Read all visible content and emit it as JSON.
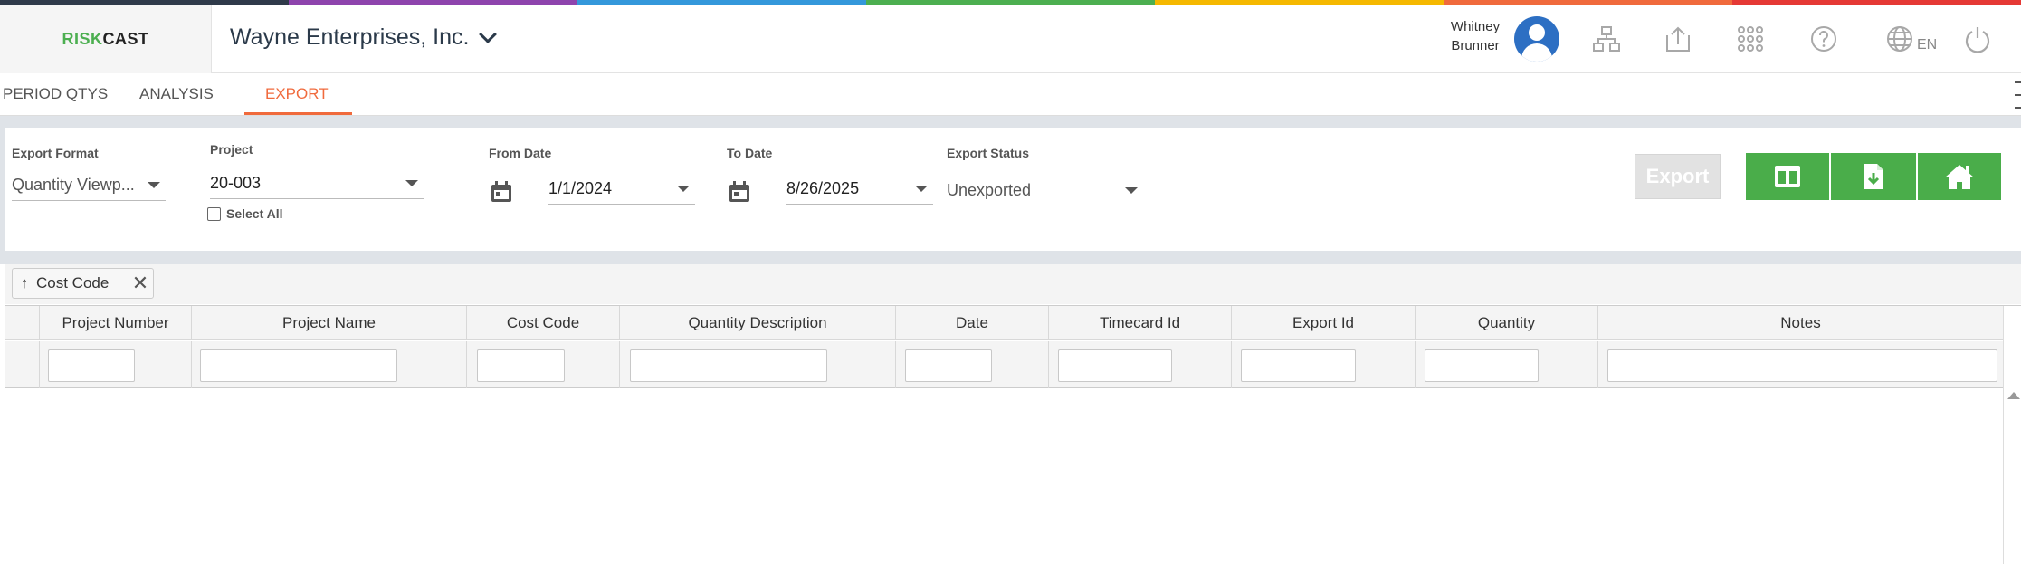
{
  "colors": {
    "rainbow": [
      "#2f3a4a",
      "#8e44ad",
      "#3498db",
      "#4caf50",
      "#f5b800",
      "#f06a3c",
      "#e53935"
    ],
    "accent": "#f06a3c",
    "green_button": "#4aad4a",
    "avatar": "#2d6fc3"
  },
  "logo": {
    "part1": "RISK",
    "part2": "CAST"
  },
  "header": {
    "company": "Wayne Enterprises, Inc.",
    "user_first": "Whitney",
    "user_last": "Brunner",
    "language": "EN",
    "icons": [
      "org-chart-icon",
      "upload-icon",
      "apps-grid-icon",
      "help-icon",
      "globe-icon",
      "power-icon"
    ]
  },
  "tabs": [
    {
      "label": "PERIOD QTYS",
      "active": false
    },
    {
      "label": "ANALYSIS",
      "active": false
    },
    {
      "label": "EXPORT",
      "active": true
    }
  ],
  "filters": {
    "export_format": {
      "label": "Export Format",
      "value": "Quantity Viewp..."
    },
    "project": {
      "label": "Project",
      "value": "20-003",
      "select_all": "Select All"
    },
    "from_date": {
      "label": "From Date",
      "value": "1/1/2024"
    },
    "to_date": {
      "label": "To Date",
      "value": "8/26/2025"
    },
    "export_status": {
      "label": "Export Status",
      "value": "Unexported"
    }
  },
  "buttons": {
    "export": "Export",
    "icon_buttons": [
      "columns-icon",
      "download-file-icon",
      "home-icon"
    ]
  },
  "grouping": {
    "chip_label": "Cost Code",
    "chip_arrow": "↑",
    "chip_remove": "✕"
  },
  "grid": {
    "columns": [
      "Project Number",
      "Project Name",
      "Cost Code",
      "Quantity Description",
      "Date",
      "Timecard Id",
      "Export Id",
      "Quantity",
      "Notes"
    ],
    "rows": []
  }
}
